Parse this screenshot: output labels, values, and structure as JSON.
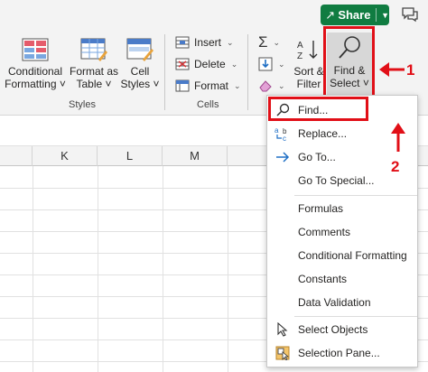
{
  "titlebar": {
    "share_label": "Share"
  },
  "ribbon": {
    "styles_group": {
      "label": "Styles",
      "conditional_formatting": [
        "Conditional",
        "Formatting ˅"
      ],
      "format_as_table": [
        "Format as",
        "Table ˅"
      ],
      "cell_styles": [
        "Cell",
        "Styles ˅"
      ]
    },
    "cells_group": {
      "label": "Cells",
      "insert": "Insert",
      "delete": "Delete",
      "format": "Format"
    },
    "editing_group": {
      "sort_filter": [
        "Sort &",
        "Filter"
      ],
      "find_select": [
        "Find &",
        "Select ˅"
      ]
    }
  },
  "columns": [
    "K",
    "L",
    "M"
  ],
  "menu": {
    "items": [
      {
        "label": "Find...",
        "icon": "search-icon"
      },
      {
        "label": "Replace...",
        "icon": "replace-icon"
      },
      {
        "label": "Go To...",
        "icon": "goto-arrow-icon"
      },
      {
        "label": "Go To Special...",
        "icon": ""
      },
      {
        "label": "Formulas",
        "icon": ""
      },
      {
        "label": "Comments",
        "icon": ""
      },
      {
        "label": "Conditional Formatting",
        "icon": ""
      },
      {
        "label": "Constants",
        "icon": ""
      },
      {
        "label": "Data Validation",
        "icon": ""
      },
      {
        "label": "Select Objects",
        "icon": "cursor-icon"
      },
      {
        "label": "Selection Pane...",
        "icon": "selection-pane-icon"
      }
    ]
  },
  "annotations": {
    "step_1": "1",
    "step_2": "2"
  },
  "colors": {
    "accent": "#107c41",
    "annotation_red": "#e10f17",
    "ribbon_bg": "#f3f3f3"
  }
}
